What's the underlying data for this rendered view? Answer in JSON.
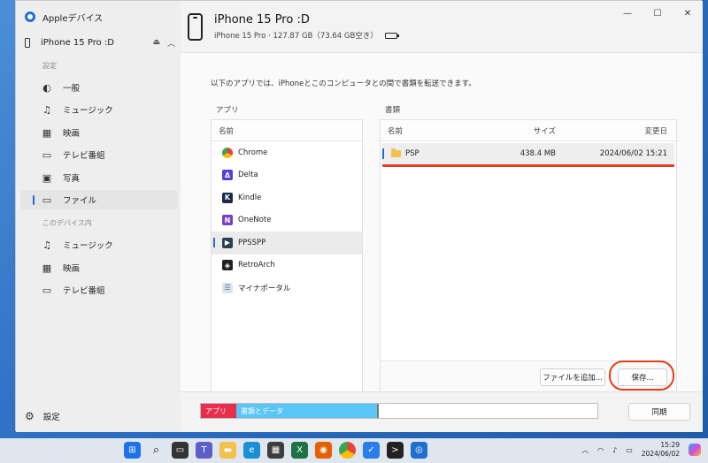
{
  "app": {
    "title": "Appleデバイス"
  },
  "sidebar": {
    "device_name": "iPhone 15 Pro :D",
    "section_settings": "設定",
    "section_on_device": "このデバイス内",
    "items": [
      {
        "label": "一般",
        "icon": "general-icon"
      },
      {
        "label": "ミュージック",
        "icon": "music-icon"
      },
      {
        "label": "映画",
        "icon": "film-icon"
      },
      {
        "label": "テレビ番組",
        "icon": "tv-icon"
      },
      {
        "label": "写真",
        "icon": "photo-icon"
      },
      {
        "label": "ファイル",
        "icon": "folder-icon"
      }
    ],
    "device_items": [
      {
        "label": "ミュージック",
        "icon": "music-icon"
      },
      {
        "label": "映画",
        "icon": "film-icon"
      },
      {
        "label": "テレビ番組",
        "icon": "tv-icon"
      }
    ],
    "settings_label": "設定"
  },
  "header": {
    "device_title": "iPhone 15 Pro :D",
    "device_subtitle": "iPhone 15 Pro · 127.87 GB（73.64 GB空き）"
  },
  "main": {
    "intro": "以下のアプリでは、iPhoneとこのコンピュータとの間で書類を転送できます。",
    "apps_label": "アプリ",
    "docs_label": "書類",
    "apps_column": "名前",
    "apps": [
      {
        "name": "Chrome"
      },
      {
        "name": "Delta"
      },
      {
        "name": "Kindle"
      },
      {
        "name": "OneNote"
      },
      {
        "name": "PPSSPP"
      },
      {
        "name": "RetroArch"
      },
      {
        "name": "マイナポータル"
      }
    ],
    "docs_columns": {
      "name": "名前",
      "size": "サイズ",
      "modified": "変更日"
    },
    "docs": [
      {
        "name": "PSP",
        "size": "438.4 MB",
        "modified": "2024/06/02 15:21"
      }
    ],
    "add_file_button": "ファイルを追加...",
    "save_button": "保存..."
  },
  "storage": {
    "apps_label": "アプリ",
    "docs_label": "書類とデータ",
    "sync_button": "同期"
  },
  "taskbar": {
    "time": "15:29",
    "date": "2024/06/02"
  },
  "colors": {
    "accent": "#1f6fd0",
    "highlight_red": "#e83b1a",
    "storage_apps": "#e72e4a",
    "storage_docs": "#5ac5f7"
  }
}
